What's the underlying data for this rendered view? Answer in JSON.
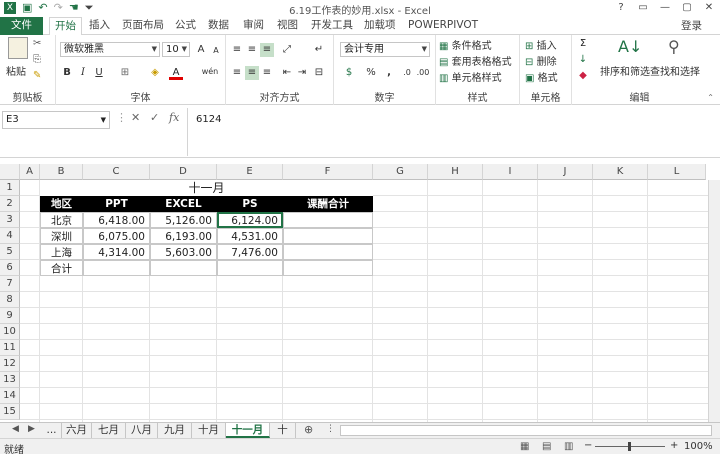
{
  "window": {
    "title": "6.19工作表的妙用.xlsx - Excel",
    "login_label": "登录"
  },
  "ribbon_tabs": [
    "文件",
    "开始",
    "插入",
    "页面布局",
    "公式",
    "数据",
    "审阅",
    "视图",
    "开发工具",
    "加载项",
    "POWERPIVOT"
  ],
  "active_tab": "开始",
  "ribbon": {
    "clipboard": {
      "paste": "粘贴",
      "label": "剪贴板"
    },
    "font": {
      "name": "微软雅黑",
      "size": "10",
      "bold": "B",
      "italic": "I",
      "underline": "U",
      "label": "字体",
      "grow": "A",
      "shrink": "A",
      "color_a": "A",
      "phonetic": "wén"
    },
    "alignment": {
      "label": "对齐方式"
    },
    "number": {
      "format": "会计专用",
      "percent": "%",
      "comma": ",",
      "label": "数字"
    },
    "styles": {
      "conditional": "条件格式",
      "table": "套用表格格式",
      "cell": "单元格样式",
      "label": "样式"
    },
    "cells": {
      "insert": "插入",
      "delete": "删除",
      "format": "格式",
      "label": "单元格"
    },
    "editing": {
      "sum": "Σ",
      "sort": "排序和筛选",
      "find": "查找和选择",
      "label": "编辑"
    }
  },
  "formula_bar": {
    "name_box": "E3",
    "fx": "fx",
    "content": "6124",
    "cancel": "✕",
    "enter": "✓"
  },
  "columns": [
    "A",
    "B",
    "C",
    "D",
    "E",
    "F",
    "G",
    "H",
    "I",
    "J",
    "K",
    "L"
  ],
  "rows": [
    "1",
    "2",
    "3",
    "4",
    "5",
    "6",
    "7",
    "8",
    "9",
    "10",
    "11",
    "12",
    "13",
    "14",
    "15"
  ],
  "sheet": {
    "title": "十一月",
    "headers": [
      "地区",
      "PPT",
      "EXCEL",
      "PS",
      "课酬合计"
    ],
    "data": [
      [
        "北京",
        "6,418.00",
        "5,126.00",
        "6,124.00",
        ""
      ],
      [
        "深圳",
        "6,075.00",
        "6,193.00",
        "4,531.00",
        ""
      ],
      [
        "上海",
        "4,314.00",
        "5,603.00",
        "7,476.00",
        ""
      ],
      [
        "合计",
        "",
        "",
        "",
        ""
      ]
    ]
  },
  "sheet_tabs": [
    "...",
    "六月",
    "七月",
    "八月",
    "九月",
    "十月",
    "十一月",
    "十"
  ],
  "active_sheet": "十一月",
  "status": {
    "ready": "就绪",
    "zoom": "100%",
    "minus": "−",
    "plus": "+"
  }
}
